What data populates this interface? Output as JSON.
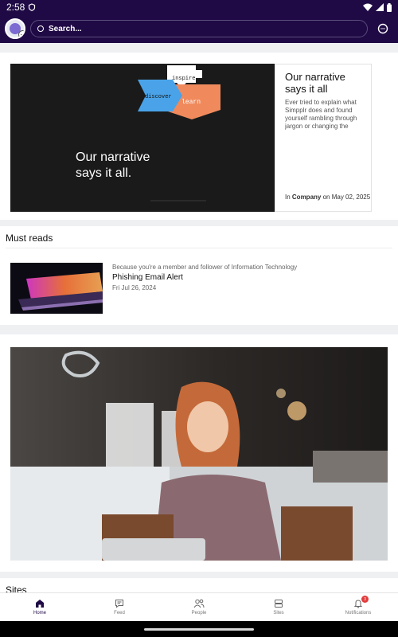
{
  "status_bar": {
    "time": "2:58"
  },
  "header": {
    "search_placeholder": "Search..."
  },
  "featured": {
    "image_text": "Our narrative says it all.",
    "image_graphic_words": [
      "inspire",
      "discover",
      "learn"
    ],
    "title": "Our narrative says it all",
    "description": "Ever tried to explain what Simpplr does and found yourself rambling through jargon or changing the su...",
    "meta_prefix": "In",
    "meta_site": "Company",
    "meta_date": "on May 02, 2025"
  },
  "must_reads": {
    "section_title": "Must reads",
    "items": [
      {
        "reason": "Because you're a member and follower of Information Technology",
        "title": "Phishing Email Alert",
        "date": "Fri Jul 26, 2024"
      }
    ]
  },
  "sites": {
    "section_title": "Sites"
  },
  "bottom_nav": [
    {
      "label": "Home",
      "icon": "home-icon",
      "active": true
    },
    {
      "label": "Feed",
      "icon": "feed-icon",
      "active": false
    },
    {
      "label": "People",
      "icon": "people-icon",
      "active": false
    },
    {
      "label": "Sites",
      "icon": "sites-icon",
      "active": false
    },
    {
      "label": "Notifications",
      "icon": "bell-icon",
      "active": false,
      "badge": "3"
    }
  ],
  "colors": {
    "brand": "#1f0a45",
    "accent_orange": "#f08a5d",
    "accent_blue": "#4aa3e8",
    "badge_red": "#e23b3b"
  }
}
